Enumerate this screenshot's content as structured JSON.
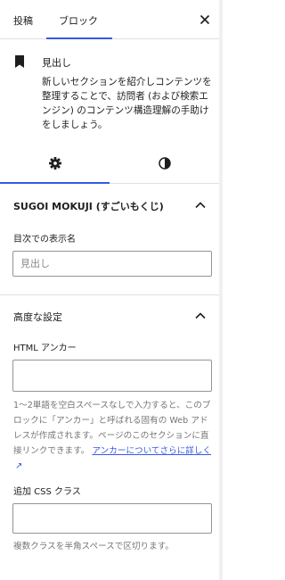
{
  "header": {
    "tab_post": "投稿",
    "tab_block": "ブロック"
  },
  "block": {
    "title": "見出し",
    "description": "新しいセクションを紹介しコンテンツを整理することで、訪問者 (および検索エンジン) のコンテンツ構造理解の手助けをしましょう。"
  },
  "icon_tabs": {
    "settings": "gear-icon",
    "styles": "contrast-icon"
  },
  "sugoi_panel": {
    "title": "SUGOI MOKUJI (すごいもくじ)",
    "field_label": "目次での表示名",
    "field_value": "見出し"
  },
  "advanced_panel": {
    "title": "高度な設定",
    "anchor_label": "HTML アンカー",
    "anchor_value": "",
    "anchor_help_prefix": "1〜2単語を空白スペースなしで入力すると、このブロックに「アンカー」と呼ばれる固有の Web アドレスが作成されます。ページのこのセクションに直接リンクできます。",
    "anchor_help_link": "アンカーについてさらに詳しく",
    "css_label": "追加 CSS クラス",
    "css_value": "",
    "css_help": "複数クラスを半角スペースで区切ります。"
  },
  "colors": {
    "accent": "#3858e9",
    "text": "#1e1e1e",
    "muted": "#757575",
    "border": "#e0e0e0"
  }
}
